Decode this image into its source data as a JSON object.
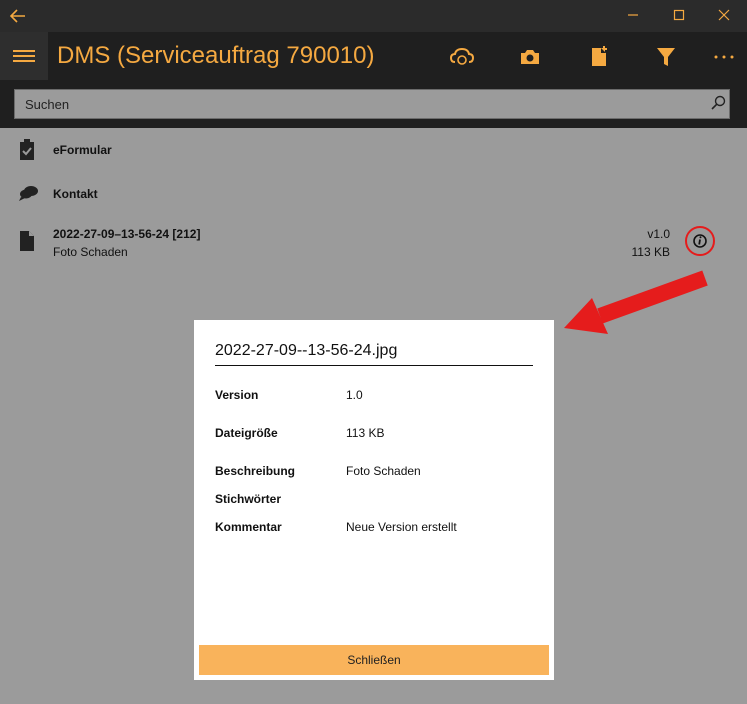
{
  "window": {
    "back_icon": "back-arrow-icon",
    "controls": [
      "minimize-icon",
      "maximize-icon",
      "close-icon"
    ]
  },
  "appbar": {
    "title": "DMS (Serviceauftrag 790010)",
    "icons": [
      "cloud-sync-icon",
      "camera-icon",
      "new-document-icon",
      "filter-icon",
      "more-icon"
    ]
  },
  "search": {
    "placeholder": "Suchen"
  },
  "list": {
    "items": [
      {
        "title": "eFormular",
        "icon": "clipboard-check-icon"
      },
      {
        "title": "Kontakt",
        "icon": "chat-bubbles-icon"
      },
      {
        "title": "2022-27-09–13-56-24 [212]",
        "subtitle": "Foto Schaden",
        "version": "v1.0",
        "size": "113 KB",
        "icon": "document-icon"
      }
    ]
  },
  "dialog": {
    "title": "2022-27-09--13-56-24.jpg",
    "fields": [
      {
        "label": "Version",
        "value": "1.0"
      },
      {
        "label": "Dateigröße",
        "value": "113 KB"
      },
      {
        "label": "Beschreibung",
        "value": "Foto Schaden"
      },
      {
        "label": "Stichwörter",
        "value": ""
      },
      {
        "label": "Kommentar",
        "value": "Neue Version erstellt"
      }
    ],
    "close_label": "Schließen"
  },
  "colors": {
    "accent": "#f5a941",
    "button": "#f9b35b",
    "annotation": "#e51c1c",
    "overlay": "#9b9b9b",
    "bar": "#1f1f1f"
  }
}
